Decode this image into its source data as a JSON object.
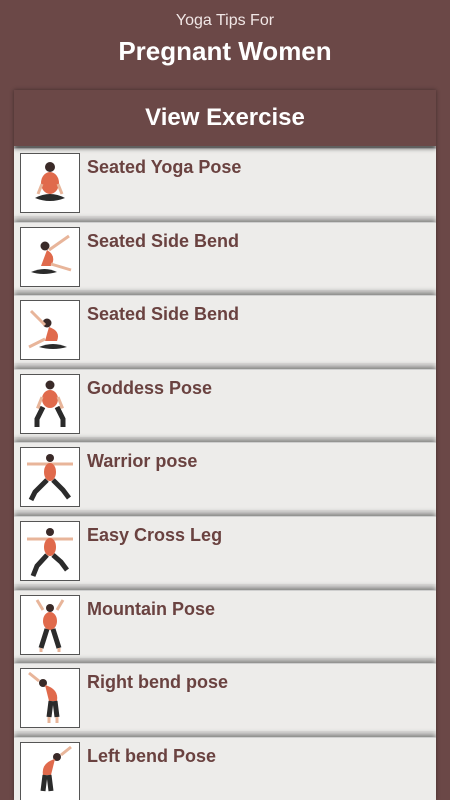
{
  "header": {
    "subtitle": "Yoga Tips For",
    "title": "Pregnant Women"
  },
  "panel": {
    "title": "View Exercise"
  },
  "colors": {
    "brand": "#6b4847",
    "label": "#6a4240",
    "row_bg": "#edecea",
    "figure": "#e06a4c",
    "hair": "#3a2a28"
  },
  "exercises": [
    {
      "label": "Seated Yoga Pose",
      "icon": "seated-yoga-icon"
    },
    {
      "label": "Seated Side Bend",
      "icon": "seated-side-bend-icon"
    },
    {
      "label": "Seated Side Bend",
      "icon": "seated-side-bend-icon"
    },
    {
      "label": "Goddess Pose",
      "icon": "goddess-pose-icon"
    },
    {
      "label": "Warrior pose",
      "icon": "warrior-pose-icon"
    },
    {
      "label": "Easy Cross Leg",
      "icon": "easy-cross-leg-icon"
    },
    {
      "label": "Mountain Pose",
      "icon": "mountain-pose-icon"
    },
    {
      "label": "Right bend pose",
      "icon": "right-bend-icon"
    },
    {
      "label": "Left bend Pose",
      "icon": "left-bend-icon"
    }
  ]
}
